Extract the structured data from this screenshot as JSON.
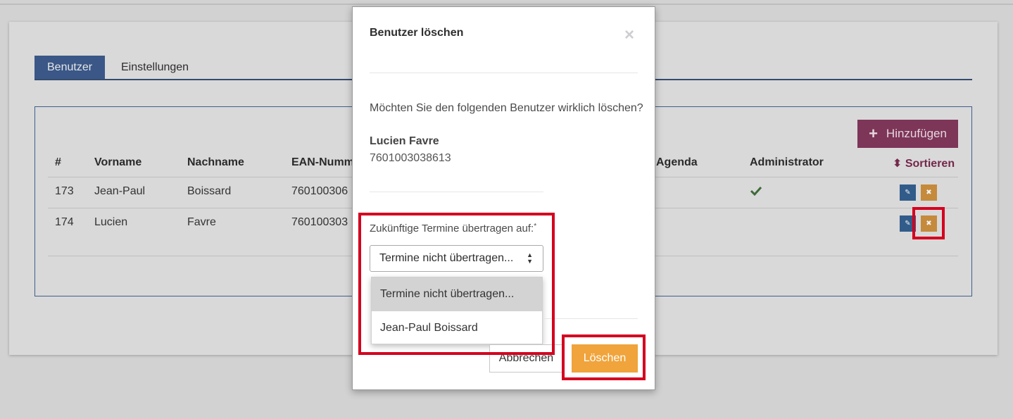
{
  "tabs": [
    {
      "label": "Benutzer",
      "active": true
    },
    {
      "label": "Einstellungen",
      "active": false
    }
  ],
  "toolbar": {
    "add_label": "Hinzufügen"
  },
  "table": {
    "headers": [
      "#",
      "Vorname",
      "Nachname",
      "EAN-Numm",
      "Agenda",
      "Administrator",
      "Sortieren"
    ],
    "rows": [
      {
        "id": "173",
        "vorname": "Jean-Paul",
        "nachname": "Boissard",
        "ean": "760100306",
        "admin": true
      },
      {
        "id": "174",
        "vorname": "Lucien",
        "nachname": "Favre",
        "ean": "760100303",
        "admin": false
      }
    ]
  },
  "modal": {
    "title": "Benutzer löschen",
    "question": "Möchten Sie den folgenden Benutzer wirklich löschen?",
    "user_name": "Lucien Favre",
    "user_ean": "7601003038613",
    "transfer_label": "Zukünftige Termine übertragen auf:",
    "required_mark": "*",
    "select_value": "Termine nicht übertragen...",
    "options": [
      "Termine nicht übertragen...",
      "Jean-Paul Boissard"
    ],
    "cancel_label": "Abbrechen",
    "delete_label": "Löschen"
  },
  "colors": {
    "primary": "#3a5787",
    "add_button": "#7d3558",
    "delete_button": "#f0a43b",
    "highlight": "#d4001f"
  },
  "icons": [
    "close-icon",
    "plus-icon",
    "sort-icon",
    "check-icon",
    "edit-icon",
    "delete-icon",
    "updown-icon"
  ]
}
